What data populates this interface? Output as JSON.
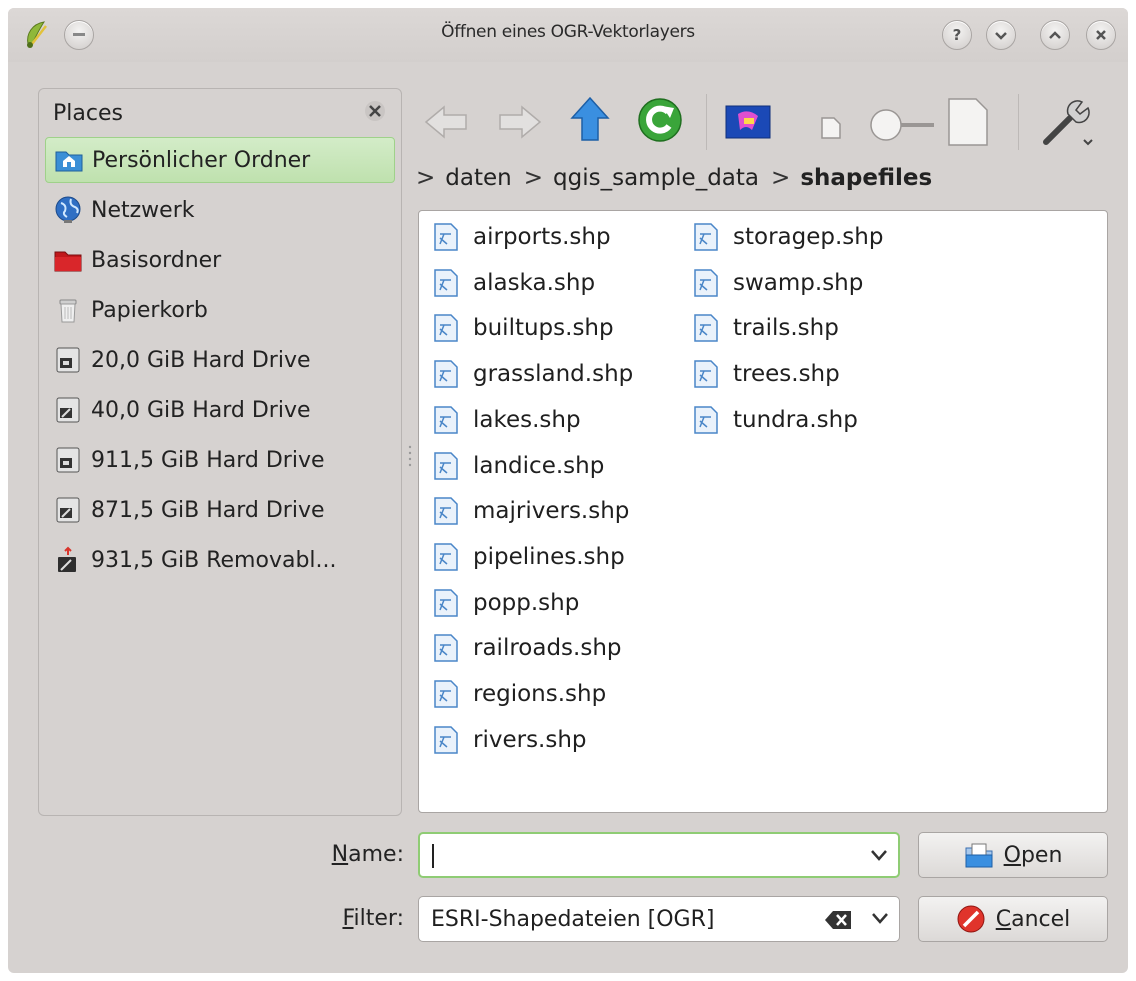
{
  "window": {
    "title": "Öffnen eines OGR-Vektorlayers",
    "titlebar_buttons": [
      "help-icon",
      "minimize-icon",
      "maximize-icon",
      "close-icon"
    ]
  },
  "places": {
    "heading": "Places",
    "items": [
      {
        "label": "Persönlicher Ordner",
        "icon": "home-folder-icon",
        "selected": true
      },
      {
        "label": "Netzwerk",
        "icon": "network-globe-icon"
      },
      {
        "label": "Basisordner",
        "icon": "root-folder-icon"
      },
      {
        "label": "Papierkorb",
        "icon": "trash-icon"
      },
      {
        "label": "20,0 GiB Hard Drive",
        "icon": "hard-drive-icon"
      },
      {
        "label": "40,0 GiB Hard Drive",
        "icon": "hard-drive-icon"
      },
      {
        "label": "911,5 GiB Hard Drive",
        "icon": "hard-drive-icon"
      },
      {
        "label": "871,5 GiB Hard Drive",
        "icon": "hard-drive-icon"
      },
      {
        "label": "931,5 GiB Removabl...",
        "icon": "removable-drive-icon"
      }
    ]
  },
  "toolbar": {
    "buttons": [
      "back-arrow-icon",
      "forward-arrow-icon",
      "up-arrow-icon",
      "reload-icon",
      "preview-icon",
      "zoom-small-icon",
      "zoom-slider",
      "zoom-large-icon",
      "options-wrench-icon"
    ]
  },
  "breadcrumb": {
    "parts": [
      "daten",
      "qgis_sample_data",
      "shapefiles"
    ],
    "separator": ">"
  },
  "files": {
    "column1": [
      "airports.shp",
      "alaska.shp",
      "builtups.shp",
      "grassland.shp",
      "lakes.shp",
      "landice.shp",
      "majrivers.shp",
      "pipelines.shp",
      "popp.shp",
      "railroads.shp",
      "regions.shp",
      "rivers.shp"
    ],
    "column2": [
      "storagep.shp",
      "swamp.shp",
      "trails.shp",
      "trees.shp",
      "tundra.shp"
    ]
  },
  "form": {
    "name_label_u": "N",
    "name_label_rest": "ame:",
    "name_value": "",
    "filter_label_u": "F",
    "filter_label_rest": "ilter:",
    "filter_value": "ESRI-Shapedateien [OGR]",
    "open_u": "O",
    "open_rest": "pen",
    "cancel_u": "C",
    "cancel_rest": "ancel"
  },
  "colors": {
    "window_bg": "#d6d2d0",
    "selection_green": "#bfe1ae",
    "focus_border": "#8fcc74"
  }
}
